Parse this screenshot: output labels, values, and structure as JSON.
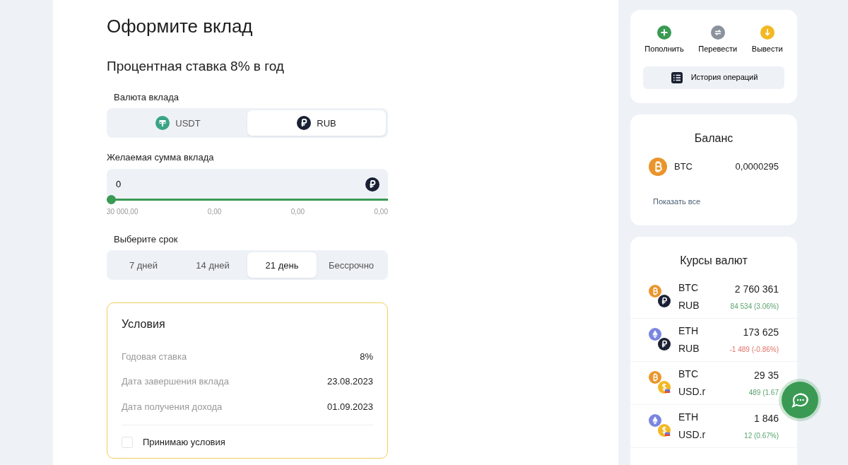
{
  "page_title": "Оформите вклад",
  "rate_heading": "Процентная ставка 8% в год",
  "currency": {
    "label": "Валюта вклада",
    "options": [
      {
        "label": "USDT",
        "kind": "usdt",
        "selected": false
      },
      {
        "label": "RUB",
        "kind": "rub",
        "selected": true
      }
    ]
  },
  "amount": {
    "label": "Желаемая сумма вклада",
    "value": "0",
    "level": 0,
    "ticks": [
      "30 000,00",
      "0,00",
      "0,00",
      "0,00"
    ]
  },
  "term": {
    "label": "Выберите срок",
    "options": [
      {
        "label": "7 дней",
        "selected": false
      },
      {
        "label": "14 дней",
        "selected": false
      },
      {
        "label": "21 день",
        "selected": true
      },
      {
        "label": "Бессрочно",
        "selected": false
      }
    ]
  },
  "conditions": {
    "title": "Условия",
    "rows": [
      {
        "label": "Годовая ставка",
        "value": "8%"
      },
      {
        "label": "Дата завершения вклада",
        "value": "23.08.2023"
      },
      {
        "label": "Дата получения дохода",
        "value": "01.09.2023"
      }
    ],
    "accept": {
      "label": "Принимаю условия",
      "checked": false
    }
  },
  "actions": [
    {
      "label": "Пополнить",
      "kind": "plus"
    },
    {
      "label": "Перевести",
      "kind": "transfer"
    },
    {
      "label": "Вывести",
      "kind": "withdraw"
    }
  ],
  "history_button": "История операций",
  "balance": {
    "title": "Баланс",
    "items": [
      {
        "coin": "BTC",
        "kind": "btc",
        "amount": "0,0000295"
      }
    ],
    "show_all": "Показать все"
  },
  "rates": {
    "title": "Курсы валют",
    "items": [
      {
        "base": {
          "label": "BTC",
          "kind": "btc"
        },
        "quote": {
          "label": "RUB",
          "kind": "rub"
        },
        "price": "2 760 361",
        "change": {
          "text": "84 534 (3.06%)",
          "kind": "up"
        }
      },
      {
        "base": {
          "label": "ETH",
          "kind": "eth"
        },
        "quote": {
          "label": "RUB",
          "kind": "rub"
        },
        "price": "173 625",
        "change": {
          "text": "-1 489 (-0.86%)",
          "kind": "down"
        }
      },
      {
        "base": {
          "label": "BTC",
          "kind": "btc"
        },
        "quote": {
          "label": "USD.r",
          "kind": "usdr"
        },
        "price": "29 35",
        "change": {
          "text": "489 (1.67",
          "kind": "up"
        }
      },
      {
        "base": {
          "label": "ETH",
          "kind": "eth"
        },
        "quote": {
          "label": "USD.r",
          "kind": "usdr"
        },
        "price": "1 846",
        "change": {
          "text": "12 (0.67%)",
          "kind": "up"
        }
      }
    ]
  }
}
